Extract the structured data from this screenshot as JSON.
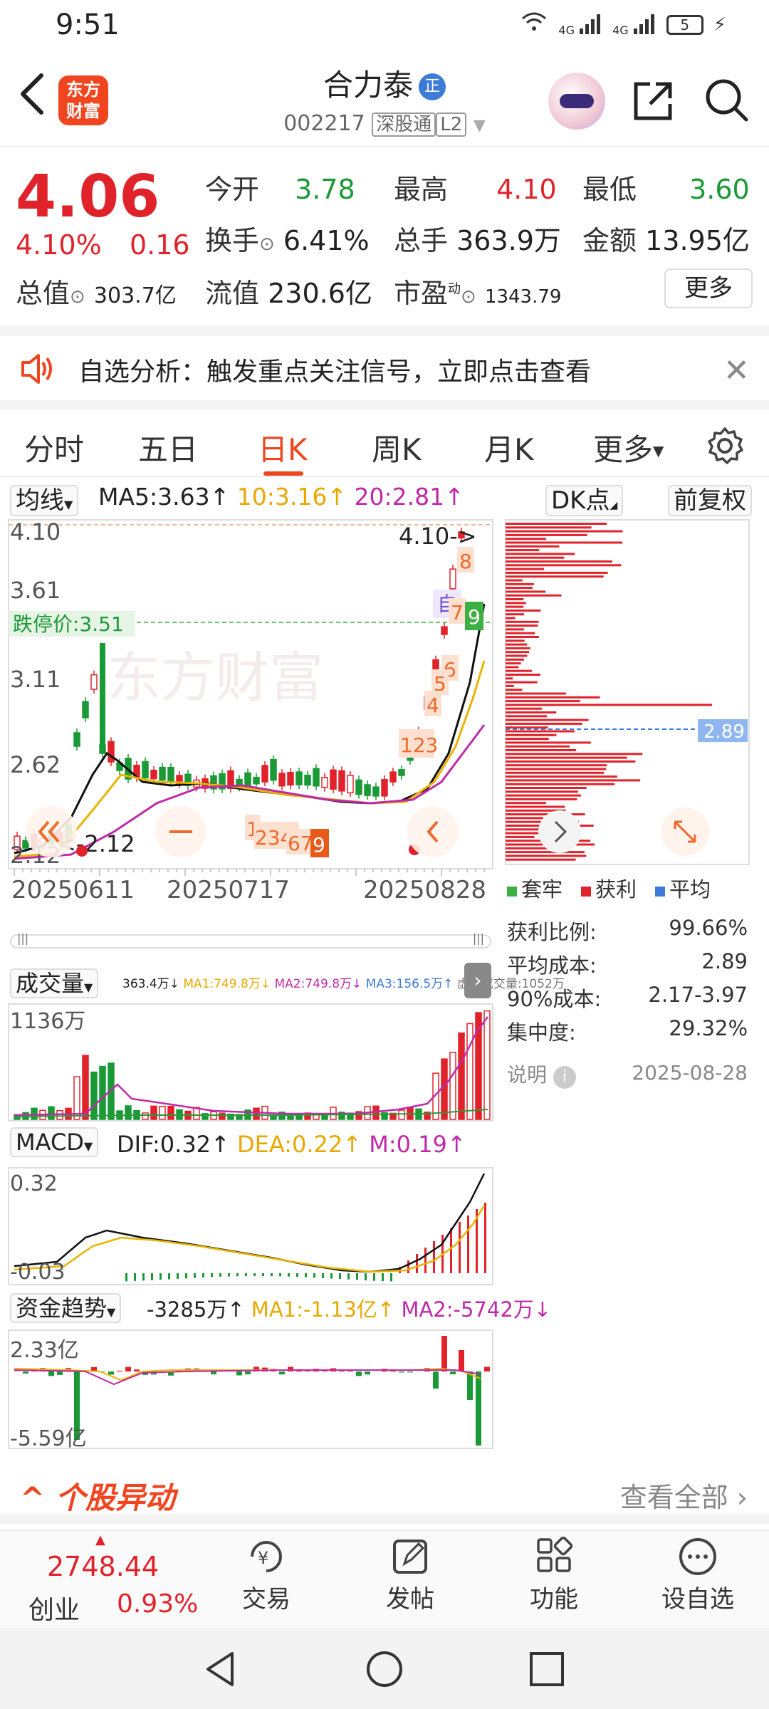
{
  "status": {
    "time": "9:51",
    "network": "4G",
    "network2": "4G",
    "battery": "5"
  },
  "header": {
    "logo_line1": "东方",
    "logo_line2": "财富",
    "stock_name": "合力泰",
    "badge": "正",
    "code": "002217",
    "tag1": "深股通",
    "tag2": "L2"
  },
  "quote": {
    "price": "4.06",
    "pct": "4.10%",
    "chg": "0.16",
    "open_label": "今开",
    "open": "3.78",
    "high_label": "最高",
    "high": "4.10",
    "low_label": "最低",
    "low": "3.60",
    "turnover_label": "换手",
    "turnover": "6.41%",
    "volume_label": "总手",
    "volume": "363.9万",
    "amount_label": "金额",
    "amount": "13.95亿",
    "mcap_label": "总值",
    "mcap": "303.7亿",
    "float_label": "流值",
    "float": "230.6亿",
    "pe_label": "市盈",
    "pe_sup": "动",
    "pe": "1343.79",
    "more": "更多"
  },
  "alert": {
    "text": "自选分析：触发重点关注信号，立即点击查看"
  },
  "tabs": [
    "分时",
    "五日",
    "日K",
    "周K",
    "月K",
    "更多"
  ],
  "kline": {
    "ma_selector": "均线",
    "ma5": "MA5:3.63↑",
    "ma10": "10:3.16↑",
    "ma20": "20:2.81↑",
    "dk": "DK点",
    "adjust": "前复权",
    "y_labels": [
      "4.10",
      "3.61",
      "3.11",
      "2.62",
      "2.12"
    ],
    "limit_down": "跌停价:3.51",
    "high_mark": "4.10->",
    "low_mark": "<-2.12",
    "self_mark": "自",
    "dates": [
      "20250611",
      "20250717",
      "20250828"
    ],
    "signals": [
      "8",
      "7",
      "9",
      "6",
      "5",
      "4",
      "123",
      "1",
      "2345",
      "678",
      "9"
    ],
    "watermark": "东方财富",
    "chip_avg": "2.89"
  },
  "volume": {
    "selector": "成交量",
    "info": "363.4万↓",
    "ma1": "MA1:749.8万↓",
    "ma2": "MA2:749.8万↓",
    "ma3": "MA3:156.5万↑",
    "virtual": "虚拟成交量:1052万",
    "max": "1136万"
  },
  "macd": {
    "selector": "MACD",
    "dif": "DIF:0.32↑",
    "dea": "DEA:0.22↑",
    "m": "M:0.19↑",
    "top": "0.32",
    "zero": "-0.03"
  },
  "fund": {
    "selector": "资金趋势",
    "val": "-3285万↑",
    "ma1": "MA1:-1.13亿↑",
    "ma2": "MA2:-5742万↓",
    "top": "2.33亿",
    "bottom": "-5.59亿"
  },
  "chips": {
    "legend": [
      "套牢",
      "获利",
      "平均"
    ],
    "legend_colors": [
      "#3cb043",
      "#e0232b",
      "#3d7bd9"
    ],
    "stats": [
      {
        "label": "获利比例:",
        "value": "99.66%"
      },
      {
        "label": "平均成本:",
        "value": "2.89"
      },
      {
        "label": "90%成本:",
        "value": "2.17-3.97"
      },
      {
        "label": "集中度:",
        "value": "29.32%"
      }
    ],
    "note": "说明",
    "date": "2025-08-28"
  },
  "section": {
    "title": "个股异动",
    "view_all": "查看全部"
  },
  "bottom_nav": {
    "index_value": "2748.44",
    "index_name": "创业",
    "index_pct": "0.93%",
    "items": [
      "交易",
      "发帖",
      "功能",
      "设自选"
    ]
  }
}
